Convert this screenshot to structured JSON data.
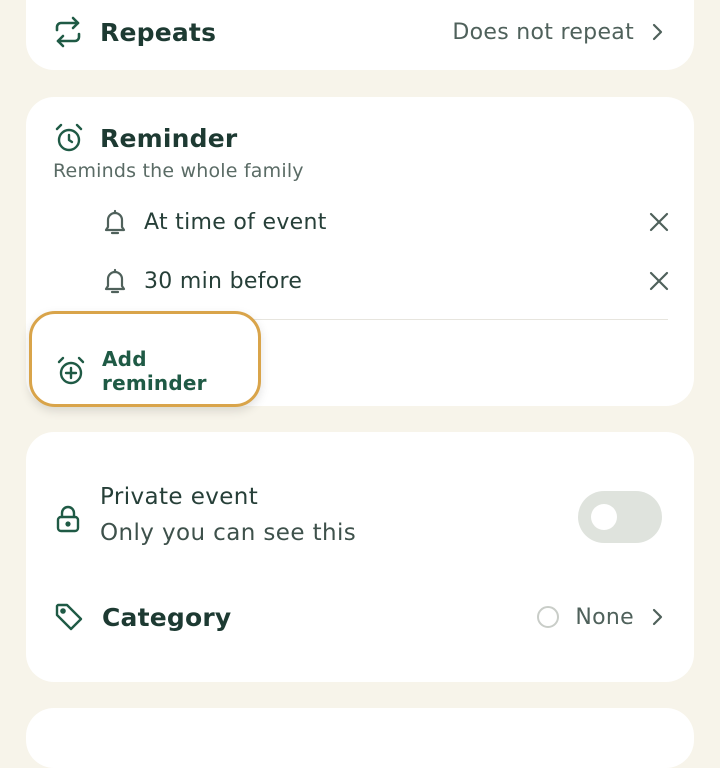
{
  "repeats": {
    "label": "Repeats",
    "value": "Does not repeat",
    "icon": "repeat-icon"
  },
  "reminder": {
    "title": "Reminder",
    "subtitle": "Reminds the whole family",
    "items": [
      {
        "label": "At time of event",
        "icon": "bell-icon"
      },
      {
        "label": "30 min before",
        "icon": "bell-icon"
      }
    ],
    "add_label": "Add reminder"
  },
  "private_event": {
    "title": "Private event",
    "subtitle": "Only you can see this",
    "enabled": false
  },
  "category": {
    "label": "Category",
    "value": "None"
  },
  "colors": {
    "accent_green": "#1f5a45",
    "highlight_ring": "#d9a44a",
    "background": "#f7f4ea"
  }
}
